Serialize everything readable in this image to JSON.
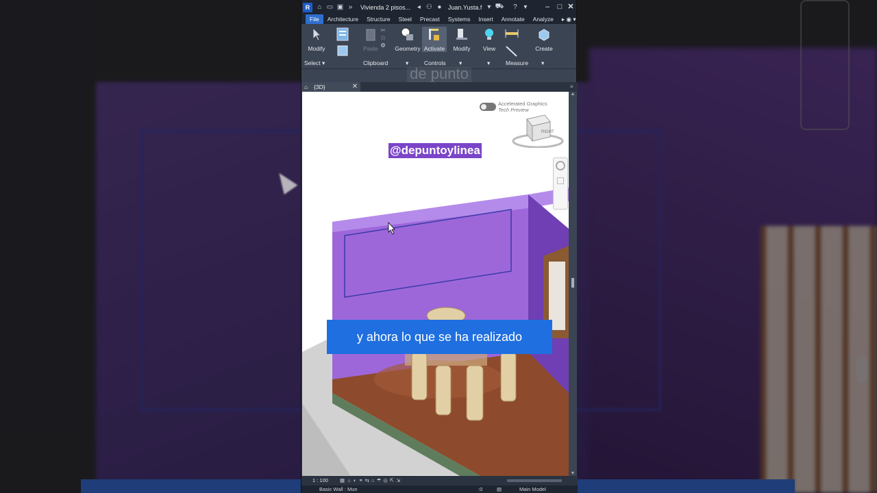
{
  "titlebar": {
    "logo": "R",
    "doc_title": "Vivienda 2 pisos...",
    "user": "Juan.Yusta.f"
  },
  "tabs": [
    "File",
    "Architecture",
    "Structure",
    "Steel",
    "Precast",
    "Systems",
    "Insert",
    "Annotate",
    "Analyze"
  ],
  "ribbon": {
    "buttons": {
      "modify1": "Modify",
      "properties": "Properties",
      "paste": "Paste",
      "geometry": "Geometry",
      "activate": "Activate",
      "modify2": "Modify",
      "view": "View",
      "create": "Create"
    },
    "panels": {
      "select": "Select",
      "clipboard": "Clipboard",
      "controls": "Controls",
      "measure": "Measure"
    }
  },
  "watermark": "de punto y linea",
  "view_tab": {
    "label": "{3D}"
  },
  "viewport": {
    "accelerated": "Accelerated Graphics",
    "tech_preview": "Tech Preview",
    "viewcube_label": "RIGHT",
    "handle": "@depuntoylinea",
    "caption": "y ahora lo que se ha realizado"
  },
  "statusbar": {
    "scale": "1 : 100",
    "element": "Basic Wall : Mun",
    "model": "Main Model",
    "count": ":0"
  },
  "colors": {
    "wall": "#8a54c9",
    "caption_bg": "#1f6fe0",
    "handle_bg": "#7a45c8",
    "ribbon_bg": "#3b4453"
  }
}
